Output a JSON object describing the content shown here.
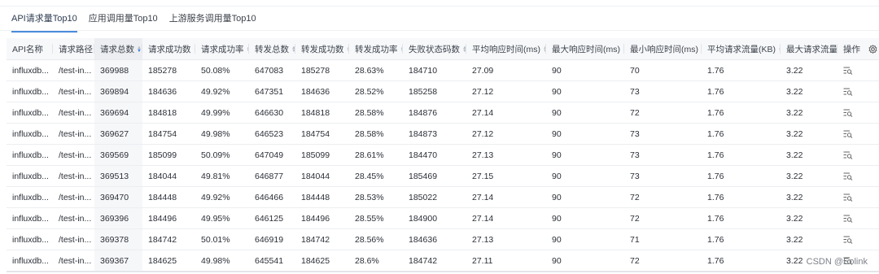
{
  "tabs": [
    "API请求量Top10",
    "应用调用量Top10",
    "上游服务调用量Top10"
  ],
  "active_tab": 0,
  "table": {
    "columns": [
      "API名称",
      "请求路径",
      "请求总数",
      "请求成功数",
      "请求成功率",
      "转发总数",
      "转发成功数",
      "转发成功率",
      "失败状态码数",
      "平均响应时间(ms)",
      "最大响应时间(ms)",
      "最小响应时间(ms)",
      "平均请求流量(KB)",
      "最大请求流量(KB)"
    ],
    "action_header": "操作",
    "rows": [
      [
        "influxdb...",
        "/test-in...",
        "369988",
        "185278",
        "50.08%",
        "647083",
        "185278",
        "28.63%",
        "184710",
        "27.09",
        "90",
        "70",
        "1.76",
        "3.22"
      ],
      [
        "influxdb...",
        "/test-in...",
        "369894",
        "184636",
        "49.92%",
        "647351",
        "184636",
        "28.52%",
        "185258",
        "27.12",
        "90",
        "73",
        "1.76",
        "3.22"
      ],
      [
        "influxdb...",
        "/test-in...",
        "369694",
        "184818",
        "49.99%",
        "646630",
        "184818",
        "28.58%",
        "184876",
        "27.14",
        "90",
        "72",
        "1.76",
        "3.22"
      ],
      [
        "influxdb...",
        "/test-in...",
        "369627",
        "184754",
        "49.98%",
        "646523",
        "184754",
        "28.58%",
        "184873",
        "27.12",
        "90",
        "73",
        "1.76",
        "3.22"
      ],
      [
        "influxdb...",
        "/test-in...",
        "369569",
        "185099",
        "50.09%",
        "647049",
        "185099",
        "28.61%",
        "184470",
        "27.13",
        "90",
        "73",
        "1.76",
        "3.22"
      ],
      [
        "influxdb...",
        "/test-in...",
        "369513",
        "184044",
        "49.81%",
        "646877",
        "184044",
        "28.45%",
        "185469",
        "27.15",
        "90",
        "73",
        "1.76",
        "3.22"
      ],
      [
        "influxdb...",
        "/test-in...",
        "369470",
        "184448",
        "49.92%",
        "646466",
        "184448",
        "28.53%",
        "185022",
        "27.14",
        "90",
        "72",
        "1.76",
        "3.22"
      ],
      [
        "influxdb...",
        "/test-in...",
        "369396",
        "184496",
        "49.95%",
        "646125",
        "184496",
        "28.55%",
        "184900",
        "27.14",
        "90",
        "72",
        "1.76",
        "3.22"
      ],
      [
        "influxdb...",
        "/test-in...",
        "369378",
        "184742",
        "50.01%",
        "646919",
        "184742",
        "28.56%",
        "184636",
        "27.13",
        "90",
        "71",
        "1.76",
        "3.22"
      ],
      [
        "influxdb...",
        "/test-in...",
        "369367",
        "184625",
        "49.98%",
        "645541",
        "184625",
        "28.6%",
        "184742",
        "27.11",
        "90",
        "72",
        "1.76",
        "3.22"
      ]
    ]
  },
  "watermark": "CSDN @Eolink",
  "colors": {
    "accent": "#4a8bdc",
    "sort_active": "#3a7be0"
  },
  "icons": {
    "settings": "gear-icon",
    "detail": "detail-icon",
    "sort": "sort-icon"
  }
}
